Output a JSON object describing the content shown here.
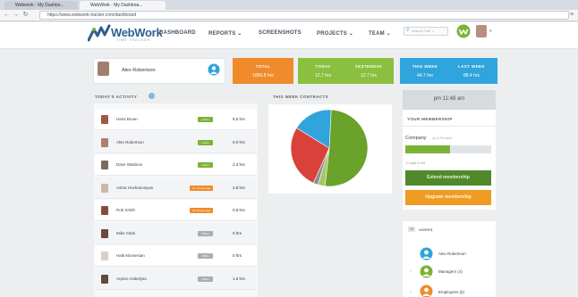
{
  "browser": {
    "tabs": [
      {
        "label": "Webwork - My Dashbo..."
      },
      {
        "label": "WebWork - My Dashboa..."
      }
    ],
    "url": "https://www.webwork-tracker.com/dashboard"
  },
  "nav": {
    "logo": "WebWork",
    "tagline": "TIME TRACKER",
    "items": [
      {
        "label": "DASHBOARD"
      },
      {
        "label": "REPORTS ⌄"
      },
      {
        "label": "SCREENSHOTS"
      },
      {
        "label": "PROJECTS ⌄"
      },
      {
        "label": "TEAM ⌄"
      }
    ],
    "search_placeholder": "Search Tool ⌄"
  },
  "user": {
    "name": "Alex Robertson"
  },
  "stats": {
    "total": {
      "label": "TOTAL",
      "value": "1850.8 hrs"
    },
    "today": {
      "label": "TODAY",
      "value": "12.7 hrs"
    },
    "yesterday": {
      "label": "YESTERDAY",
      "value": "12.7 hrs"
    },
    "this_week": {
      "label": "THIS WEEK",
      "value": "44.7 hrs"
    },
    "last_week": {
      "label": "LAST WEEK",
      "value": "88.4 hrs"
    }
  },
  "activity": {
    "title": "TODAY'S ACTIVITY",
    "rows": [
      {
        "name": "Hans Bruen",
        "badge": "online",
        "badge_color": "#7cb236",
        "hours": "5.5 hrs",
        "avatar_color": "#9c5a48"
      },
      {
        "name": "Alex Robertson",
        "badge": "online",
        "badge_color": "#7cb236",
        "hours": "0.0 hrs",
        "avatar_color": "#b07d6e"
      },
      {
        "name": "Dave Wattison",
        "badge": "online",
        "badge_color": "#7cb236",
        "hours": "2.3 hrs",
        "avatar_color": "#7a6b60"
      },
      {
        "name": "Ashot Hovhannisyan",
        "badge": "10 minutes ago",
        "badge_color": "#f08a2b",
        "hours": "2.8 hrs",
        "avatar_color": "#c9b9a8"
      },
      {
        "name": "Rob Smith",
        "badge": "10 minutes ago",
        "badge_color": "#f08a2b",
        "hours": "0.8 hrs",
        "avatar_color": "#8a4b3a"
      },
      {
        "name": "Mike Clark",
        "badge": "offline",
        "badge_color": "#a9aeb3",
        "hours": "0 hrs",
        "avatar_color": "#6a4a3a"
      },
      {
        "name": "Haik Movsesian",
        "badge": "offline",
        "badge_color": "#a9aeb3",
        "hours": "0 hrs",
        "avatar_color": "#d7d0c8"
      },
      {
        "name": "Arpine Arakelyan",
        "badge": "offline",
        "badge_color": "#a9aeb3",
        "hours": "1.9 hrs",
        "avatar_color": "#5e4a40"
      }
    ]
  },
  "contracts": {
    "title": "THIS WEEK CONTRACTS",
    "chart_data": {
      "type": "pie",
      "slices": [
        {
          "value": 51,
          "color": "#6aa22b"
        },
        {
          "value": 3,
          "color": "#a9c56a"
        },
        {
          "value": 2,
          "color": "#8e8e8e"
        },
        {
          "value": 27,
          "color": "#d9423b"
        },
        {
          "value": 17,
          "color": "#2fa4dd"
        }
      ]
    }
  },
  "clock": {
    "text": "pm 11:48 am"
  },
  "membership": {
    "title": "YOUR MEMBERSHIP",
    "plan": "Company",
    "plan_sub": "up to 30 users",
    "progress": 0.52,
    "days_left": "21 days to left",
    "extend_label": "Extend membership",
    "upgrade_label": "Upgrade membership"
  },
  "users": {
    "count": "10",
    "title": "USERS",
    "items": [
      {
        "label": "Alex Robertson"
      },
      {
        "label": "Managers (4)"
      },
      {
        "label": "Employees (5)"
      }
    ]
  }
}
